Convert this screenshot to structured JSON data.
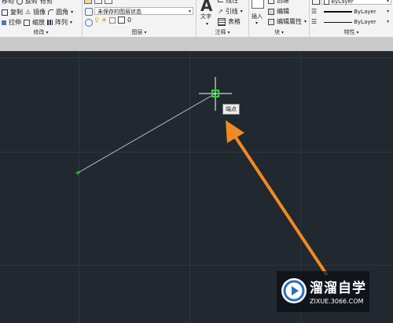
{
  "modify_panel": {
    "items": [
      [
        "移动",
        "旋转",
        "修剪"
      ],
      [
        "复制",
        "镜像",
        "圆角"
      ],
      [
        "拉伸",
        "缩放",
        "阵列"
      ]
    ],
    "title": "修改"
  },
  "layers_panel": {
    "layer_state": "未保存的图层状态",
    "current_layer": "0",
    "title": "图层"
  },
  "annotation_panel": {
    "text_label": "文字",
    "items": [
      "线性",
      "引线",
      "表格"
    ],
    "title": "注释"
  },
  "block_panel": {
    "insert_label": "插入",
    "items": [
      "创建",
      "编辑",
      "编辑属性"
    ],
    "title": "块"
  },
  "properties_panel": {
    "color": "ByLayer",
    "linetype": "ByLayer",
    "lineweight": "ByLayer",
    "title": "特性"
  },
  "canvas": {
    "snap_tooltip": "端点"
  },
  "watermark": {
    "title": "溜溜自学",
    "url": "ZIXUE.3066.COM"
  },
  "colors": {
    "canvas_bg": "#212830",
    "line": "#b8bcc2",
    "crosshair": "#ffffff",
    "snap_marker": "#22dd22",
    "arrow": "#f08a24"
  }
}
